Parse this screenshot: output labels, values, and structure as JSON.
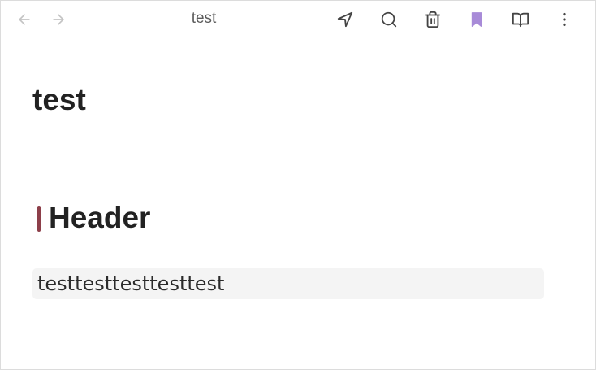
{
  "titlebar": {
    "view_title": "test",
    "nav": {
      "back_icon": "arrow-left-icon",
      "forward_icon": "arrow-right-icon"
    },
    "actions": [
      {
        "icon": "send-icon"
      },
      {
        "icon": "search-icon"
      },
      {
        "icon": "trash-icon"
      },
      {
        "icon": "bookmark-icon",
        "color": "#a88bd8"
      },
      {
        "icon": "book-open-icon"
      },
      {
        "icon": "more-vertical-icon"
      }
    ]
  },
  "note": {
    "inline_title": "test",
    "heading": "Header",
    "heading_accent_color": "#8d3f4a",
    "code_line": "testtesttesttesttest"
  }
}
